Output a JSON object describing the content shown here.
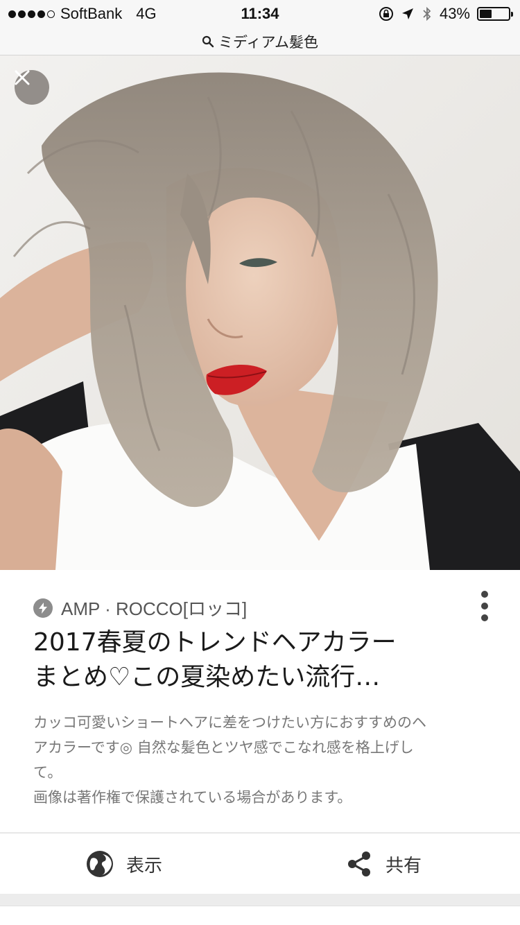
{
  "status_bar": {
    "carrier": "SoftBank",
    "network": "4G",
    "time": "11:34",
    "battery": "43%",
    "battery_level": 0.43,
    "signal_bars_filled": 4,
    "signal_bars_total": 5,
    "icons": [
      "lock-rotation-icon",
      "location-arrow-icon",
      "bluetooth-icon",
      "battery-icon"
    ]
  },
  "search_bar": {
    "query": "ミディアム髪色",
    "icon": "search-icon"
  },
  "image_viewer": {
    "close_icon": "close-icon"
  },
  "result": {
    "source": "AMP · ROCCO[ロッコ]",
    "source_icon": "amp-lightning-icon",
    "title_line1": "2017春夏のトレンドヘアカラー",
    "title_line2": "まとめ♡この夏染めたい流行…",
    "description_lines": [
      "カッコ可愛いショートヘアに差をつけたい方におすすめのヘ",
      "アカラーです◎ 自然な髪色とツヤ感でこなれ感を格上げし",
      "て。"
    ],
    "copyright_note": "画像は著作権で保護されている場合があります。",
    "more_icon": "more-vertical-icon"
  },
  "actions": {
    "view_label": "表示",
    "view_icon": "globe-icon",
    "share_label": "共有",
    "share_icon": "share-icon"
  },
  "colors": {
    "hair": "#a2988c",
    "lips": "#cc1f24",
    "background": "#eeecea"
  }
}
